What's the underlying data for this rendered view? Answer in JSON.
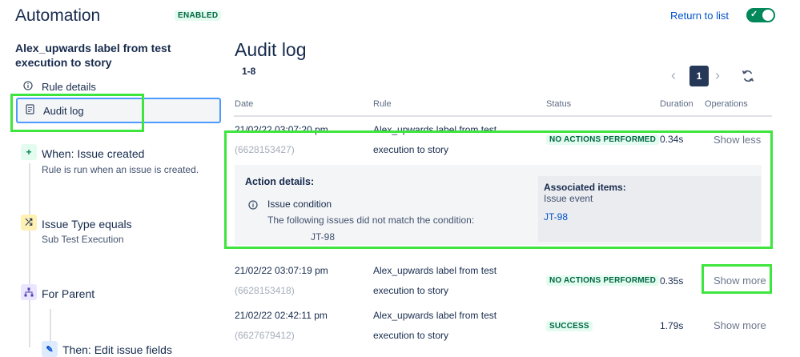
{
  "header": {
    "title": "Automation",
    "status_badge": "ENABLED",
    "return_link": "Return to list",
    "toggle_on": true
  },
  "sidebar": {
    "rule_name": "Alex_upwards label from test execution to story",
    "nav": [
      {
        "label": "Rule details",
        "icon": "info-icon"
      },
      {
        "label": "Audit log",
        "icon": "document-icon",
        "selected": true
      }
    ],
    "components": [
      {
        "title": "When: Issue created",
        "subtitle": "Rule is run when an issue is created.",
        "icon": "plus-icon"
      },
      {
        "title": "Issue Type equals",
        "subtitle": "Sub Test Execution",
        "icon": "shuffle-icon"
      },
      {
        "title": "For Parent",
        "subtitle": "",
        "icon": "hierarchy-icon"
      },
      {
        "title": "Then: Edit issue fields",
        "subtitle": "",
        "icon": "pencil-icon"
      }
    ]
  },
  "main": {
    "title": "Audit log",
    "range": "1-8",
    "pagination": {
      "current": "1"
    },
    "columns": [
      "Date",
      "Rule",
      "Status",
      "Duration",
      "Operations"
    ],
    "rows": [
      {
        "date": "21/02/22 03:07:20 pm",
        "id": "(6628153427)",
        "rule_line1": "Alex_upwards label from test",
        "rule_line2": "execution to story",
        "status": "NO ACTIONS PERFORMED",
        "duration": "0.34s",
        "operation": "Show less"
      },
      {
        "date": "21/02/22 03:07:19 pm",
        "id": "(6628153418)",
        "rule_line1": "Alex_upwards label from test",
        "rule_line2": "execution to story",
        "status": "NO ACTIONS PERFORMED",
        "duration": "0.35s",
        "operation": "Show more"
      },
      {
        "date": "21/02/22 02:42:11 pm",
        "id": "(6627679412)",
        "rule_line1": "Alex_upwards label from test",
        "rule_line2": "execution to story",
        "status": "SUCCESS",
        "duration": "1.79s",
        "operation": "Show more"
      }
    ],
    "details": {
      "heading": "Action details:",
      "item_title": "Issue condition",
      "item_desc": "The following issues did not match the condition:",
      "item_value": "JT-98",
      "assoc_heading": "Associated items:",
      "assoc_sub": "Issue event",
      "assoc_link": "JT-98"
    }
  },
  "colors": {
    "highlight": "#3ee53e",
    "accent": "#0052cc",
    "success": "#00875a"
  }
}
